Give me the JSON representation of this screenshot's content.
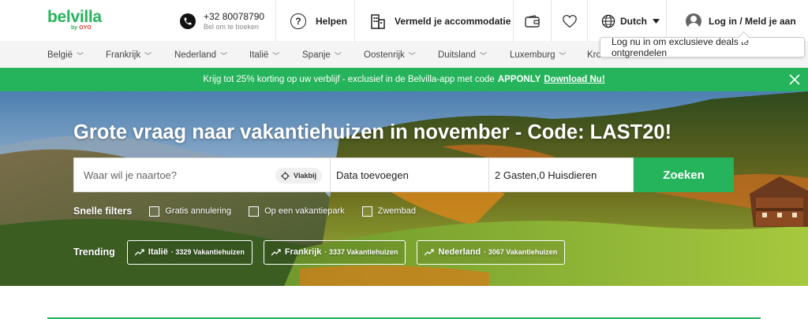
{
  "header": {
    "logo_text": "belvilla",
    "logo_by": "by",
    "logo_oyo": "OYO",
    "phone_number": "+32 80078790",
    "phone_sub": "Bel om te boeken",
    "help_label": "Helpen",
    "list_label": "Vermeld je accommodatie",
    "language_label": "Dutch",
    "login_label": "Log in / Meld je aan"
  },
  "tooltip": {
    "text": "Log nu in om exclusieve deals te ontgrendelen"
  },
  "nav": {
    "items": [
      {
        "label": "België"
      },
      {
        "label": "Frankrijk"
      },
      {
        "label": "Nederland"
      },
      {
        "label": "Italië"
      },
      {
        "label": "Spanje"
      },
      {
        "label": "Oostenrijk"
      },
      {
        "label": "Duitsland"
      },
      {
        "label": "Luxemburg"
      },
      {
        "label": "Kro"
      }
    ]
  },
  "promo": {
    "text_before": "Krijg tot 25% korting op uw verblijf - exclusief in de Belvilla-app met code",
    "code": "APPONLY",
    "download": "Download Nu!"
  },
  "hero": {
    "title": "Grote vraag naar vakantiehuizen in november - Code: LAST20!",
    "search": {
      "where_placeholder": "Waar wil je naartoe?",
      "nearby_label": "Vlakbij",
      "dates_label": "Data toevoegen",
      "guests_label": "2 Gasten,0 Huisdieren",
      "search_button": "Zoeken"
    },
    "filters": {
      "title": "Snelle filters",
      "options": [
        {
          "label": "Gratis annulering"
        },
        {
          "label": "Op een vakantiepark"
        },
        {
          "label": "Zwembad"
        }
      ]
    },
    "trending": {
      "title": "Trending",
      "chips": [
        {
          "name": "Italië",
          "count": "· 3329 Vakantiehuizen"
        },
        {
          "name": "Frankrijk",
          "count": "· 3337 Vakantiehuizen"
        },
        {
          "name": "Nederland",
          "count": "· 3067 Vakantiehuizen"
        }
      ]
    }
  },
  "colors": {
    "brand": "#25b35b",
    "oyo_red": "#e53935"
  }
}
